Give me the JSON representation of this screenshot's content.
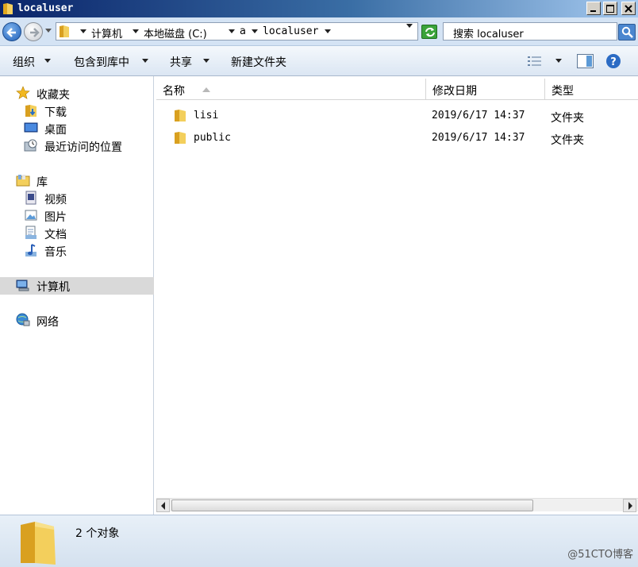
{
  "window": {
    "title": "localuser"
  },
  "address": {
    "crumbs": [
      "计算机",
      "本地磁盘 (C:)",
      "a",
      "localuser"
    ]
  },
  "search": {
    "placeholder": "搜索 localuser"
  },
  "toolbar": {
    "organize": "组织",
    "include_library": "包含到库中",
    "share": "共享",
    "new_folder": "新建文件夹"
  },
  "nav": {
    "favorites": "收藏夹",
    "downloads": "下载",
    "desktop": "桌面",
    "recent": "最近访问的位置",
    "libraries": "库",
    "videos": "视频",
    "pictures": "图片",
    "documents": "文档",
    "music": "音乐",
    "computer": "计算机",
    "network": "网络"
  },
  "columns": {
    "name": "名称",
    "modified": "修改日期",
    "type": "类型"
  },
  "files": [
    {
      "name": "lisi",
      "modified": "2019/6/17 14:37",
      "type": "文件夹"
    },
    {
      "name": "public",
      "modified": "2019/6/17 14:37",
      "type": "文件夹"
    }
  ],
  "status": {
    "count_text": "2 个对象"
  },
  "watermark": "@51CTO博客",
  "colors": {
    "title_bar": "#0a246a",
    "folder": "#f0c040",
    "selection": "#d9d9d9"
  }
}
